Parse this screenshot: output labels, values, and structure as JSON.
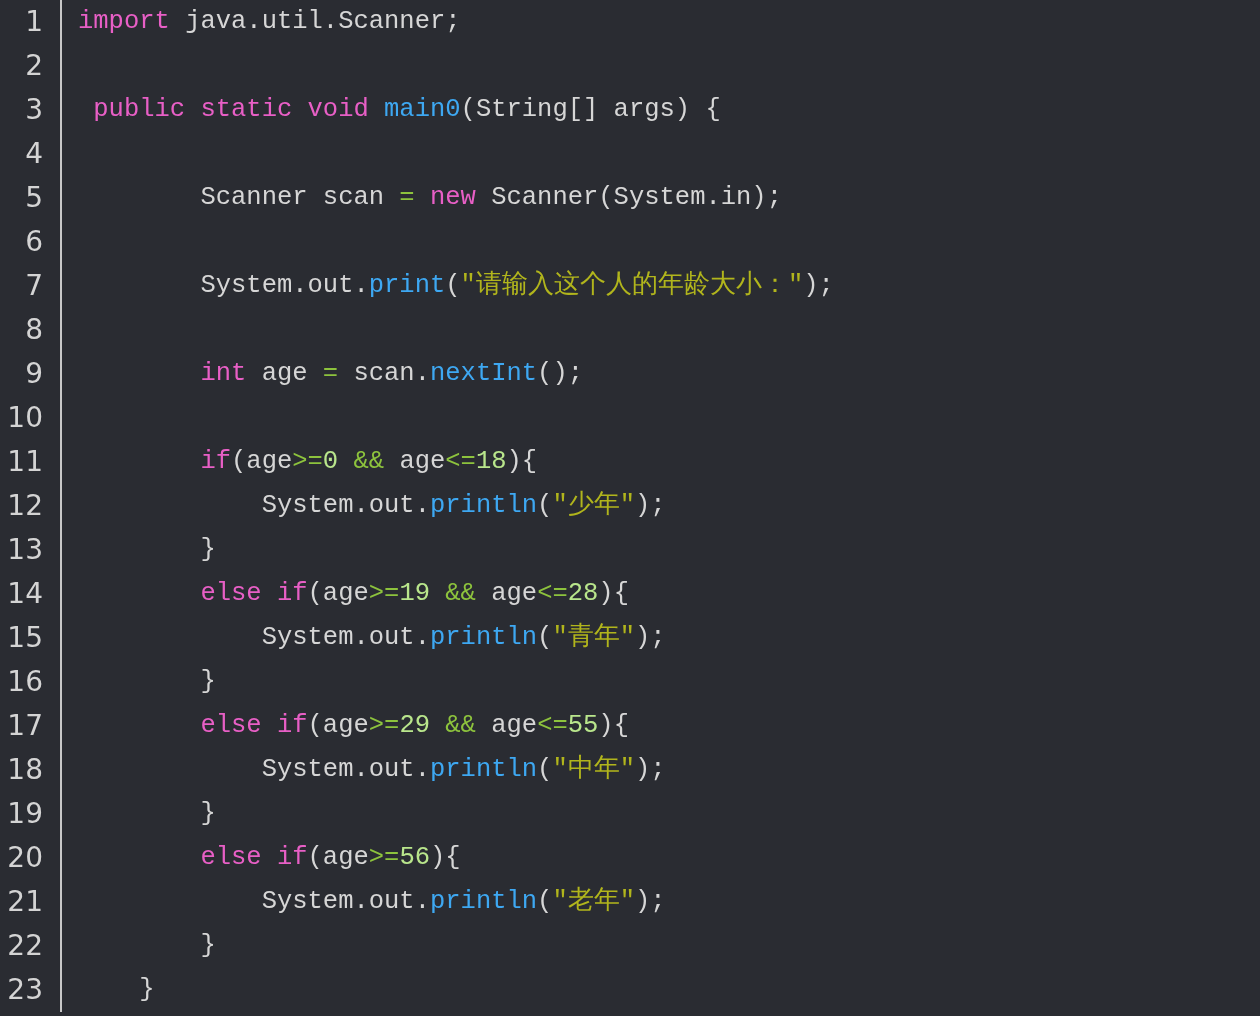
{
  "editor": {
    "lines": [
      {
        "number": "1",
        "tokens": [
          {
            "kind": "keyword",
            "text": "import"
          },
          {
            "kind": "plain",
            "text": " java.util.Scanner;"
          }
        ]
      },
      {
        "number": "2"
      },
      {
        "number": "3",
        "tokens": [
          {
            "kind": "keyword",
            "text": " public "
          },
          {
            "kind": "keyword",
            "text": "static "
          },
          {
            "kind": "keyword",
            "text": "void "
          },
          {
            "kind": "function",
            "text": "main0"
          },
          {
            "kind": "plain",
            "text": "(String[] args) {"
          }
        ]
      },
      {
        "number": "4"
      },
      {
        "number": "5",
        "tokens": [
          {
            "kind": "plain",
            "text": "        Scanner scan "
          },
          {
            "kind": "operator",
            "text": "= "
          },
          {
            "kind": "keyword",
            "text": "new"
          },
          {
            "kind": "plain",
            "text": " Scanner(System.in);"
          }
        ]
      },
      {
        "number": "6"
      },
      {
        "number": "7",
        "tokens": [
          {
            "kind": "plain",
            "text": "        System.out."
          },
          {
            "kind": "function",
            "text": "print"
          },
          {
            "kind": "plain",
            "text": "("
          },
          {
            "kind": "string",
            "text": "\"请输入这个人的年龄大小：\""
          },
          {
            "kind": "plain",
            "text": ");"
          }
        ]
      },
      {
        "number": "8"
      },
      {
        "number": "9",
        "tokens": [
          {
            "kind": "keyword",
            "text": "        int"
          },
          {
            "kind": "plain",
            "text": " age "
          },
          {
            "kind": "operator",
            "text": "="
          },
          {
            "kind": "plain",
            "text": " scan."
          },
          {
            "kind": "function",
            "text": "nextInt"
          },
          {
            "kind": "plain",
            "text": "();"
          }
        ]
      },
      {
        "number": "10"
      },
      {
        "number": "11",
        "tokens": [
          {
            "kind": "keyword",
            "text": "        if"
          },
          {
            "kind": "plain",
            "text": "(age"
          },
          {
            "kind": "operator",
            "text": ">="
          },
          {
            "kind": "number",
            "text": "0 "
          },
          {
            "kind": "operator",
            "text": "&&"
          },
          {
            "kind": "plain",
            "text": " age"
          },
          {
            "kind": "operator",
            "text": "<="
          },
          {
            "kind": "number",
            "text": "18"
          },
          {
            "kind": "plain",
            "text": "){"
          }
        ]
      },
      {
        "number": "12",
        "tokens": [
          {
            "kind": "plain",
            "text": "            System.out."
          },
          {
            "kind": "function",
            "text": "println"
          },
          {
            "kind": "plain",
            "text": "("
          },
          {
            "kind": "string",
            "text": "\"少年\""
          },
          {
            "kind": "plain",
            "text": ");"
          }
        ]
      },
      {
        "number": "13",
        "tokens": [
          {
            "kind": "plain",
            "text": "        }"
          }
        ]
      },
      {
        "number": "14",
        "tokens": [
          {
            "kind": "keyword",
            "text": "        else "
          },
          {
            "kind": "keyword",
            "text": "if"
          },
          {
            "kind": "plain",
            "text": "(age"
          },
          {
            "kind": "operator",
            "text": ">="
          },
          {
            "kind": "number",
            "text": "19 "
          },
          {
            "kind": "operator",
            "text": "&&"
          },
          {
            "kind": "plain",
            "text": " age"
          },
          {
            "kind": "operator",
            "text": "<="
          },
          {
            "kind": "number",
            "text": "28"
          },
          {
            "kind": "plain",
            "text": "){"
          }
        ]
      },
      {
        "number": "15",
        "tokens": [
          {
            "kind": "plain",
            "text": "            System.out."
          },
          {
            "kind": "function",
            "text": "println"
          },
          {
            "kind": "plain",
            "text": "("
          },
          {
            "kind": "string",
            "text": "\"青年\""
          },
          {
            "kind": "plain",
            "text": ");"
          }
        ]
      },
      {
        "number": "16",
        "tokens": [
          {
            "kind": "plain",
            "text": "        }"
          }
        ]
      },
      {
        "number": "17",
        "tokens": [
          {
            "kind": "keyword",
            "text": "        else "
          },
          {
            "kind": "keyword",
            "text": "if"
          },
          {
            "kind": "plain",
            "text": "(age"
          },
          {
            "kind": "operator",
            "text": ">="
          },
          {
            "kind": "number",
            "text": "29 "
          },
          {
            "kind": "operator",
            "text": "&&"
          },
          {
            "kind": "plain",
            "text": " age"
          },
          {
            "kind": "operator",
            "text": "<="
          },
          {
            "kind": "number",
            "text": "55"
          },
          {
            "kind": "plain",
            "text": "){"
          }
        ]
      },
      {
        "number": "18",
        "tokens": [
          {
            "kind": "plain",
            "text": "            System.out."
          },
          {
            "kind": "function",
            "text": "println"
          },
          {
            "kind": "plain",
            "text": "("
          },
          {
            "kind": "string",
            "text": "\"中年\""
          },
          {
            "kind": "plain",
            "text": ");"
          }
        ]
      },
      {
        "number": "19",
        "tokens": [
          {
            "kind": "plain",
            "text": "        }"
          }
        ]
      },
      {
        "number": "20",
        "tokens": [
          {
            "kind": "keyword",
            "text": "        else "
          },
          {
            "kind": "keyword",
            "text": "if"
          },
          {
            "kind": "plain",
            "text": "(age"
          },
          {
            "kind": "operator",
            "text": ">="
          },
          {
            "kind": "number",
            "text": "56"
          },
          {
            "kind": "plain",
            "text": "){"
          }
        ]
      },
      {
        "number": "21",
        "tokens": [
          {
            "kind": "plain",
            "text": "            System.out."
          },
          {
            "kind": "function",
            "text": "println"
          },
          {
            "kind": "plain",
            "text": "("
          },
          {
            "kind": "string",
            "text": "\"老年\""
          },
          {
            "kind": "plain",
            "text": ");"
          }
        ]
      },
      {
        "number": "22",
        "tokens": [
          {
            "kind": "plain",
            "text": "        }"
          }
        ]
      },
      {
        "number": "23",
        "tokens": [
          {
            "kind": "plain",
            "text": "    }"
          }
        ]
      }
    ]
  }
}
